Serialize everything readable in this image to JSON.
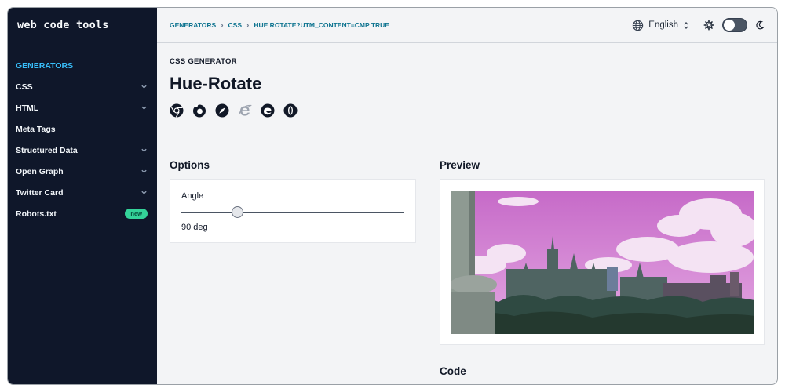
{
  "sidebar": {
    "logo": "web code tools",
    "items": [
      {
        "label": "GENERATORS",
        "active": true,
        "chevron": false,
        "badge": ""
      },
      {
        "label": "CSS",
        "active": false,
        "chevron": true,
        "badge": ""
      },
      {
        "label": "HTML",
        "active": false,
        "chevron": true,
        "badge": ""
      },
      {
        "label": "Meta Tags",
        "active": false,
        "chevron": false,
        "badge": ""
      },
      {
        "label": "Structured Data",
        "active": false,
        "chevron": true,
        "badge": ""
      },
      {
        "label": "Open Graph",
        "active": false,
        "chevron": true,
        "badge": ""
      },
      {
        "label": "Twitter Card",
        "active": false,
        "chevron": true,
        "badge": ""
      },
      {
        "label": "Robots.txt",
        "active": false,
        "chevron": false,
        "badge": "new"
      }
    ]
  },
  "breadcrumb": [
    "GENERATORS",
    "CSS",
    "HUE ROTATE?UTM_CONTENT=CMP TRUE"
  ],
  "topbar": {
    "language": "English",
    "icons": [
      "globe-icon",
      "updown-icon",
      "gear-icon",
      "moon-icon"
    ]
  },
  "header": {
    "eyebrow": "CSS GENERATOR",
    "title": "Hue-Rotate",
    "browsers": [
      "chrome-icon",
      "firefox-icon",
      "safari-icon",
      "ie-icon",
      "edge-icon",
      "opera-icon"
    ]
  },
  "options": {
    "title": "Options",
    "angle_label": "Angle",
    "angle_value": "90 deg",
    "slider_fraction": 0.25
  },
  "preview": {
    "title": "Preview"
  },
  "code": {
    "title": "Code"
  },
  "colors": {
    "sidebar_bg": "#0f172a",
    "accent": "#38bdf8",
    "badge": "#34d399",
    "crumb": "#0e7490"
  }
}
